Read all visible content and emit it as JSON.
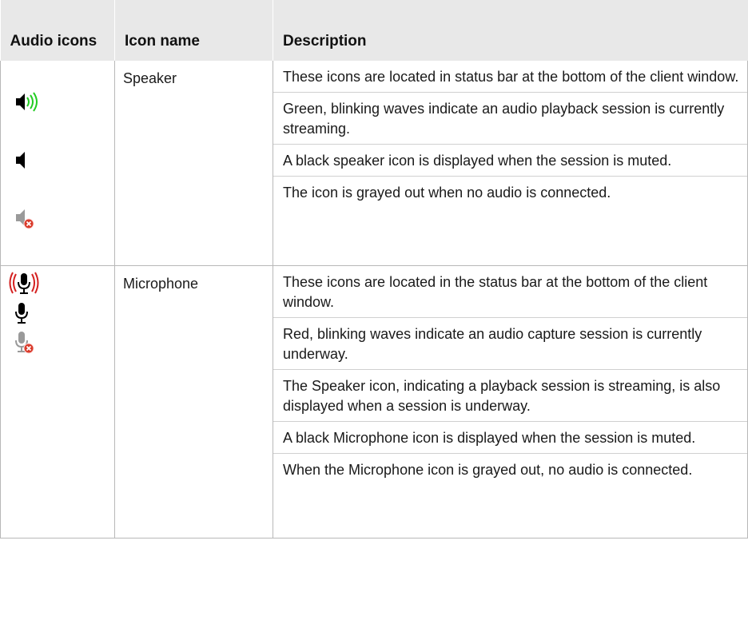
{
  "table": {
    "headers": [
      "Audio icons",
      "Icon name",
      "Description"
    ],
    "rows": [
      {
        "icons": [
          "speaker-green-waves-icon",
          "speaker-black-icon",
          "speaker-grayed-out-icon"
        ],
        "name": "Speaker",
        "description": [
          "These icons are located in status bar at the bottom of the client window.",
          "Green, blinking waves indicate an audio playback session is currently streaming.",
          "A black speaker icon is displayed when the session is muted.",
          "The icon is grayed out when no audio is connected."
        ]
      },
      {
        "icons": [
          "microphone-red-waves-icon",
          "microphone-black-icon",
          "microphone-grayed-out-icon"
        ],
        "name": "Microphone",
        "description": [
          "These icons are located in the status bar at the bottom of the client window.",
          "Red, blinking waves indicate an audio capture session is currently underway.",
          "The Speaker icon, indicating a playback session is streaming, is also displayed when a session is underway.",
          "A black Microphone icon is displayed when the session is muted.",
          "When the Microphone icon is grayed out, no audio is connected."
        ]
      }
    ]
  },
  "colors": {
    "header_bg": "#e8e8e8",
    "grid": "#b8b8b8",
    "wave_green": "#22cc22",
    "wave_red": "#d42020",
    "muted_gray": "#9a9a9a",
    "mute_badge": "#d93a2a"
  }
}
